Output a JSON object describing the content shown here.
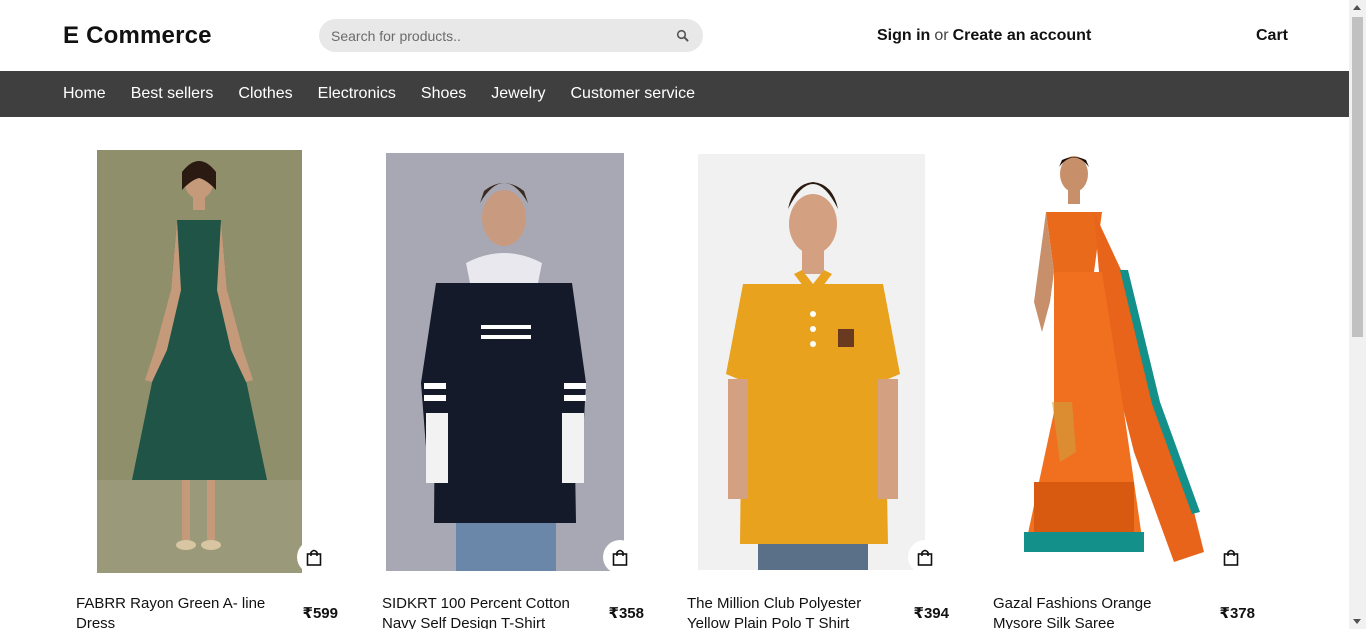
{
  "header": {
    "brand": "E Commerce",
    "search_placeholder": "Search for products..",
    "sign_in": "Sign in",
    "or": "or",
    "create_account": "Create an account",
    "cart": "Cart"
  },
  "nav": {
    "items": [
      "Home",
      "Best sellers",
      "Clothes",
      "Electronics",
      "Shoes",
      "Jewelry",
      "Customer service"
    ]
  },
  "products": [
    {
      "title": "FABRR Rayon Green A- line Dress",
      "price": "₹599"
    },
    {
      "title": "SIDKRT 100 Percent Cotton Navy Self Design T-Shirt",
      "price": "₹358"
    },
    {
      "title": "The Million Club Polyester Yellow Plain Polo T Shirt",
      "price": "₹394"
    },
    {
      "title": "Gazal Fashions Orange Mysore Silk Saree",
      "price": "₹378"
    }
  ],
  "colors": {
    "nav_bg": "#3f3f3f",
    "search_bg": "#e8e8e8"
  }
}
